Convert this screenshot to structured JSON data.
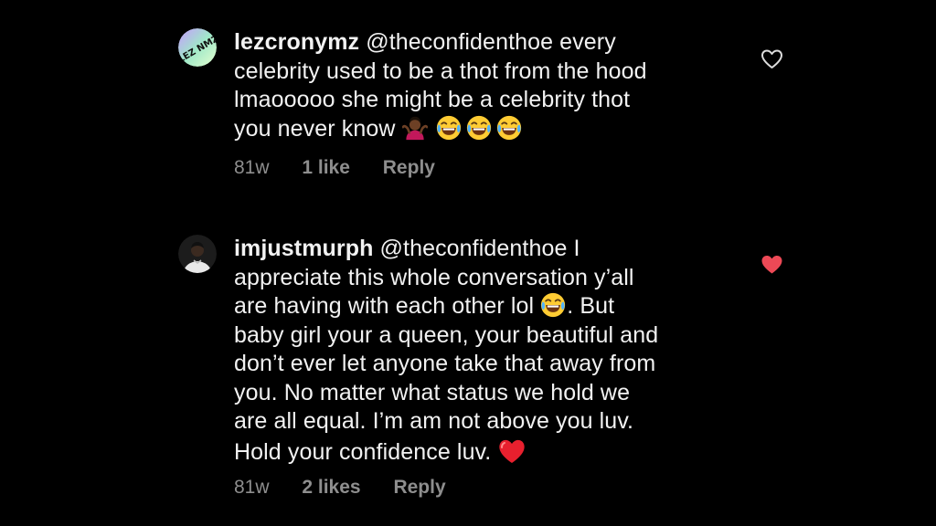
{
  "comments": [
    {
      "username": "lezcronymz",
      "mention": "@theconfidenthoe",
      "lines": [
        " every",
        "celebrity used to be a thot from the hood",
        "lmaooooo she might be a celebrity thot",
        "you never know "
      ],
      "time": "81w",
      "likes": "1 like",
      "reply": "Reply",
      "liked": false,
      "avatar_text": "LEZ NMZ"
    },
    {
      "username": "imjustmurph",
      "mention": "@theconfidenthoe",
      "lines": [
        " I",
        "appreciate this whole conversation y’all",
        "are having with each other lol ",
        ". But",
        "baby girl your a queen, your beautiful and",
        "don’t ever let anyone take that away from",
        "you. No matter what status we hold we",
        "are all equal. I’m am not above you luv.",
        "Hold your confidence luv. "
      ],
      "time": "81w",
      "likes": "2 likes",
      "reply": "Reply",
      "liked": true
    }
  ],
  "icons": {
    "heart_outline": "heart-outline-icon",
    "heart_filled": "heart-filled-icon",
    "shrug": "person-shrugging-emoji",
    "laugh": "face-with-tears-of-joy-emoji",
    "red_heart": "red-heart-emoji"
  },
  "colors": {
    "background": "#000000",
    "text": "#f2f2f2",
    "meta": "#8e8e8e",
    "like_red": "#ed4956"
  }
}
